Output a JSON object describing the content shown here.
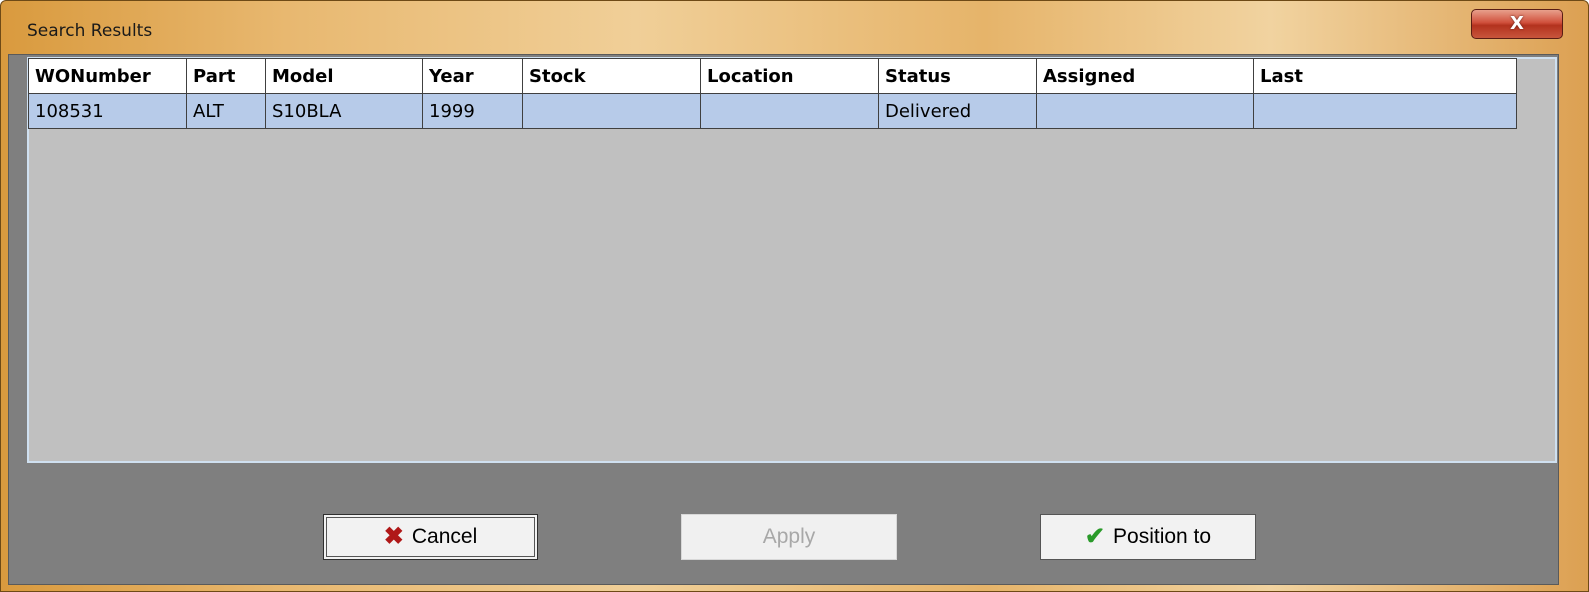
{
  "window": {
    "title": "Search Results",
    "close_glyph": "X",
    "close_icon": "close-icon"
  },
  "grid": {
    "columns": [
      "WONumber",
      "Part",
      "Model",
      "Year",
      "Stock",
      "Location",
      "Status",
      "Assigned",
      "Last"
    ],
    "rows": [
      {
        "wonumber": "108531",
        "part": "ALT",
        "model": "S10BLA",
        "year": "1999",
        "stock": "",
        "location": "",
        "status": "Delivered",
        "assigned": "",
        "last": ""
      }
    ]
  },
  "buttons": {
    "cancel": {
      "label": "Cancel",
      "icon": "x-icon",
      "icon_glyph": "✖"
    },
    "apply": {
      "label": "Apply",
      "enabled": false
    },
    "position": {
      "label": "Position to",
      "icon": "checkmark-icon",
      "icon_glyph": "✔"
    }
  },
  "colors": {
    "selected_row": "#b7cbe9",
    "grid_background": "#c0c0c0",
    "panel_background": "#7f7f7f",
    "title_bar": "#e8b870"
  }
}
